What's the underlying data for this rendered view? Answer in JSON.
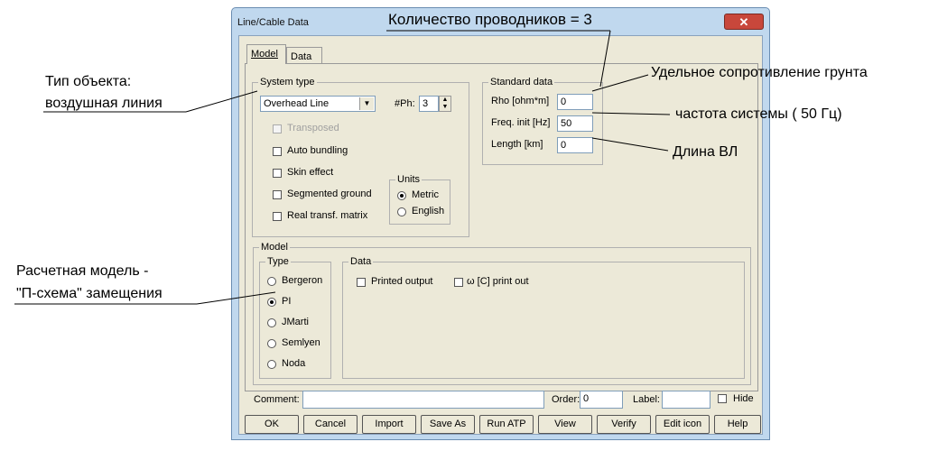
{
  "window": {
    "title": "Line/Cable Data",
    "close_glyph": "✕"
  },
  "tabs": [
    {
      "label": "Model"
    },
    {
      "label": "Data"
    }
  ],
  "system_type": {
    "legend": "System type",
    "combo_value": "Overhead Line",
    "ph_label": "#Ph:",
    "ph_value": "3",
    "checkboxes": [
      {
        "label": "Transposed",
        "checked": false,
        "disabled": true
      },
      {
        "label": "Auto bundling",
        "checked": false,
        "disabled": false
      },
      {
        "label": "Skin effect",
        "checked": false,
        "disabled": false
      },
      {
        "label": "Segmented ground",
        "checked": false,
        "disabled": false
      },
      {
        "label": "Real transf. matrix",
        "checked": false,
        "disabled": false
      }
    ],
    "units": {
      "legend": "Units",
      "options": [
        {
          "label": "Metric",
          "checked": true
        },
        {
          "label": "English",
          "checked": false
        }
      ]
    }
  },
  "standard_data": {
    "legend": "Standard data",
    "fields": [
      {
        "label": "Rho [ohm*m]",
        "value": "0"
      },
      {
        "label": "Freq. init [Hz]",
        "value": "50"
      },
      {
        "label": "Length [km]",
        "value": "0"
      }
    ]
  },
  "model": {
    "legend": "Model",
    "type": {
      "legend": "Type",
      "options": [
        {
          "label": "Bergeron",
          "checked": false
        },
        {
          "label": "PI",
          "checked": true
        },
        {
          "label": "JMarti",
          "checked": false
        },
        {
          "label": "Semlyen",
          "checked": false
        },
        {
          "label": "Noda",
          "checked": false
        }
      ]
    },
    "data": {
      "legend": "Data",
      "printed_output": "Printed output",
      "omega_print": "ω [C] print out"
    }
  },
  "footer": {
    "comment_label": "Comment:",
    "comment_value": "",
    "order_label": "Order:",
    "order_value": "0",
    "label_label": "Label:",
    "label_value": "",
    "hide_label": "Hide"
  },
  "buttons": [
    {
      "label": "OK"
    },
    {
      "label": "Cancel"
    },
    {
      "label": "Import"
    },
    {
      "label": "Save As"
    },
    {
      "label": "Run ATP"
    },
    {
      "label": "View"
    },
    {
      "label": "Verify"
    },
    {
      "label": "Edit icon"
    },
    {
      "label": "Help"
    }
  ],
  "annotations": {
    "conductors": "Количество проводников = 3",
    "object_type_1": "Тип объекта:",
    "object_type_2": "воздушная линия",
    "soil": "Удельное сопротивление грунта",
    "frequency": "частота системы   ( 50 Гц)",
    "length": "Длина ВЛ",
    "model_1": "Расчетная модель -",
    "model_2": "\"П-схема\" замещения"
  }
}
